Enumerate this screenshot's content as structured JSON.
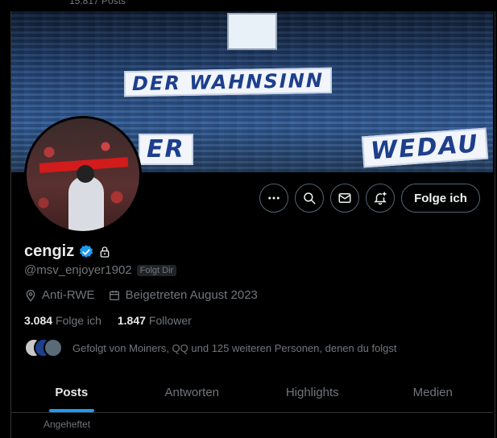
{
  "header": {
    "posts_count": "15.817 Posts"
  },
  "banner": {
    "text_top": "DER WAHNSINN",
    "text_left": "ER",
    "text_right": "WEDAU"
  },
  "actions": {
    "more_icon": "more-horizontal-icon",
    "search_icon": "search-icon",
    "message_icon": "mail-icon",
    "notify_icon": "bell-plus-icon",
    "follow_label": "Folge ich"
  },
  "profile": {
    "name": "cengiz",
    "handle": "@msv_enjoyer1902",
    "follows_you_badge": "Folgt Dir",
    "location": "Anti-RWE",
    "joined": "Beigetreten August 2023",
    "following_count": "3.084",
    "following_label": "Folge ich",
    "followers_count": "1.847",
    "followers_label": "Follower",
    "followed_by": "Gefolgt von Moiners, QQ und 125 weiteren Personen, denen du folgst"
  },
  "tabs": [
    {
      "label": "Posts",
      "active": true
    },
    {
      "label": "Antworten",
      "active": false
    },
    {
      "label": "Highlights",
      "active": false
    },
    {
      "label": "Medien",
      "active": false
    }
  ],
  "below_tabs_hint": "Angeheftet",
  "colors": {
    "accent": "#1d9bf0",
    "verified": "#1d9bf0",
    "background": "#000000",
    "secondary_text": "#71767b"
  }
}
